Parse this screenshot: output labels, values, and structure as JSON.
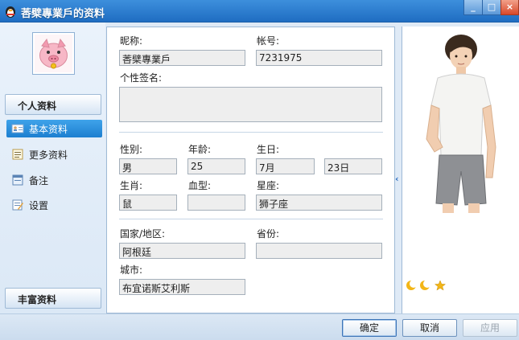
{
  "window": {
    "title": "莕檗專業戶的资料"
  },
  "titlebar_buttons": {
    "minimize": "_",
    "maximize": "□",
    "close": "×"
  },
  "sidebar": {
    "section_personal": "个人资料",
    "items": [
      {
        "label": "基本资料",
        "icon": "id-card-icon",
        "active": true
      },
      {
        "label": "更多资料",
        "icon": "list-icon"
      },
      {
        "label": "备注",
        "icon": "note-icon"
      },
      {
        "label": "设置",
        "icon": "settings-icon"
      }
    ],
    "section_rich": "丰富资料"
  },
  "form": {
    "nickname_label": "昵称:",
    "nickname": "莕檗專業戶",
    "account_label": "帐号:",
    "account": "7231975",
    "signature_label": "个性签名:",
    "signature": "",
    "gender_label": "性别:",
    "gender": "男",
    "age_label": "年龄:",
    "age": "25",
    "birthday_label": "生日:",
    "birth_month": "7月",
    "birth_day": "23日",
    "zodiac_label": "生肖:",
    "zodiac": "鼠",
    "blood_label": "血型:",
    "blood": "",
    "constellation_label": "星座:",
    "constellation": "狮子座",
    "country_label": "国家/地区:",
    "country": "阿根廷",
    "province_label": "省份:",
    "province": "",
    "city_label": "城市:",
    "city": "布宜诺斯艾利斯"
  },
  "show_panel": {
    "collapse_glyph": "‹",
    "level_icons": [
      "moon-icon",
      "moon-icon",
      "star-icon"
    ]
  },
  "buttons": {
    "ok": "确定",
    "cancel": "取消",
    "apply": "应用"
  },
  "colors": {
    "accent": "#1d7fd0",
    "titlebar": "#2a7bd0",
    "field_bg": "#eeeeee"
  }
}
